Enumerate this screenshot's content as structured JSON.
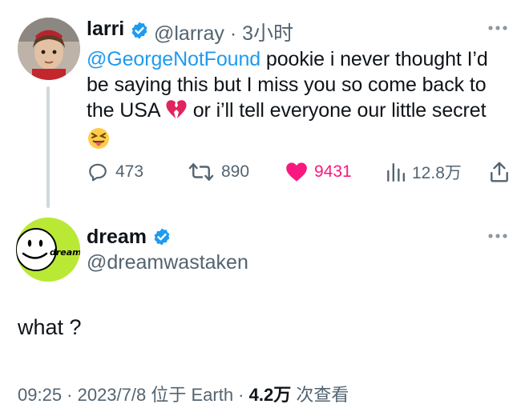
{
  "tweet": {
    "display_name": "larri",
    "handle_time": "@larray · 3小时",
    "mention": "@GeorgeNotFound",
    "text_line1_rest": " pookie i never thought I’d",
    "text_line2": "be saying this but I miss you so come back to",
    "text_line3_a": "the USA ",
    "text_line3_b": " or i’ll tell everyone our little secret",
    "emojis": [
      "broken-heart-icon",
      "squinting-tongue-face-icon"
    ],
    "stats": {
      "replies": "473",
      "retweets": "890",
      "likes": "9431",
      "views": "12.8万"
    },
    "colors": {
      "mention": "#1d9bf0",
      "like": "#f91880",
      "verified": "#1d9bf0"
    }
  },
  "reply": {
    "display_name": "dream",
    "handle": "@dreamwastaken",
    "avatar_text": "dream",
    "text": "what ?",
    "time_date": "09:25 · 2023/7/8 位于 Earth · ",
    "views_count": "4.2万",
    "views_suffix": " 次查看"
  }
}
